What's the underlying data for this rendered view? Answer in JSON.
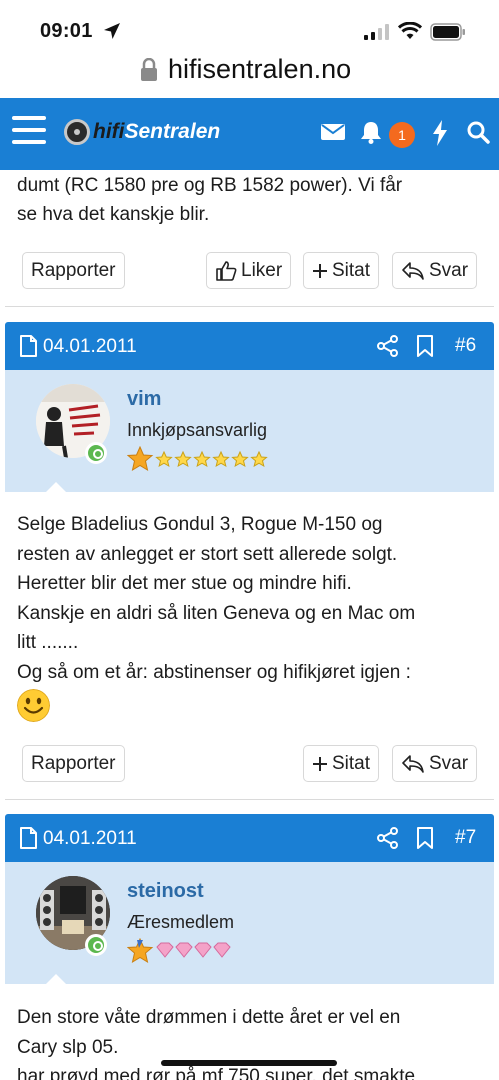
{
  "status": {
    "time": "09:01"
  },
  "browser": {
    "url": "hifisentralen.no"
  },
  "header": {
    "logo_part1": "hifi",
    "logo_part2": "Sentralen",
    "notifications_count": "1"
  },
  "prev_post": {
    "text_line1": "dumt (RC 1580 pre og RB 1582 power). Vi får",
    "text_line2": "se hva det kanskje blir.",
    "report_label": "Rapporter",
    "like_label": "Liker",
    "quote_label": "Sitat",
    "reply_label": "Svar"
  },
  "post6": {
    "date": "04.01.2011",
    "number": "#6",
    "username": "vim",
    "user_title": "Innkjøpsansvarlig",
    "lines": [
      "Selge Bladelius Gondul 3, Rogue M-150 og",
      "resten av anlegget er stort sett allerede solgt.",
      "Heretter blir det mer stue og mindre hifi.",
      "Kanskje en aldri så liten Geneva og en Mac om",
      "litt .......",
      "Og så om et år: abstinenser og hifikjøret igjen :"
    ],
    "report_label": "Rapporter",
    "quote_label": "Sitat",
    "reply_label": "Svar"
  },
  "post7": {
    "date": "04.01.2011",
    "number": "#7",
    "username": "steinost",
    "user_title": "Æresmedlem",
    "lines": [
      "Den store våte drømmen i dette året er vel en",
      "Cary slp 05.",
      "har prøvd med rør på mf 750 super. det smakte"
    ]
  },
  "colors": {
    "brand_blue": "#1a7fd4",
    "user_bg": "#d3e5f6",
    "badge_orange": "#f46a1e",
    "online_green": "#5cb84f"
  }
}
